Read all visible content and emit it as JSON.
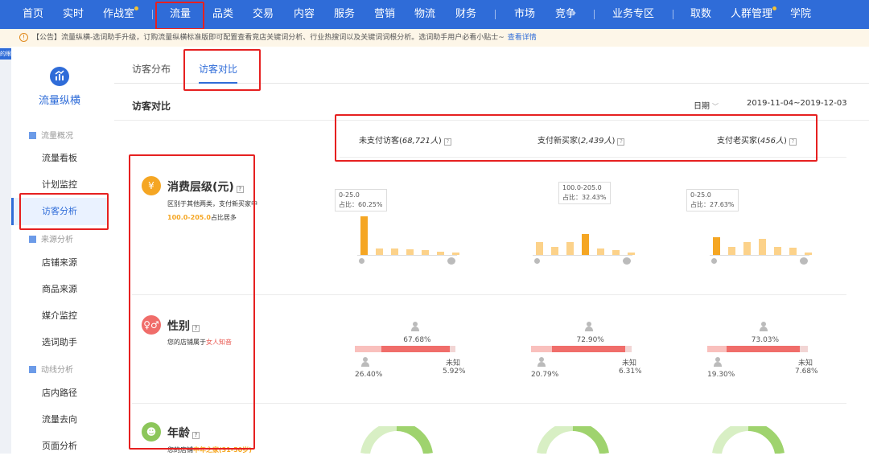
{
  "nav": {
    "items": [
      "首页",
      "实时",
      "作战室",
      "流量",
      "品类",
      "交易",
      "内容",
      "服务",
      "营销",
      "物流",
      "财务",
      "市场",
      "竞争",
      "业务专区",
      "取数",
      "人群管理",
      "学院"
    ],
    "active": "流量",
    "accent": "#2f6cd8"
  },
  "notice": {
    "text": "【公告】流量纵横-选词助手升级，订购流量纵横标准版即可配置查看竞店关键词分析、行业热搜词以及关键词词根分析。选词助手用户必看小贴士~",
    "link": "查看详情"
  },
  "left_strip": {
    "badge": "的眼"
  },
  "sidebar": {
    "title": "流量纵横",
    "sections": [
      {
        "label": "流量概况",
        "items": [
          "流量看板",
          "计划监控",
          "访客分析"
        ]
      },
      {
        "label": "来源分析",
        "items": [
          "店铺来源",
          "商品来源",
          "媒介监控",
          "选词助手"
        ]
      },
      {
        "label": "动线分析",
        "items": [
          "店内路径",
          "流量去向",
          "页面分析"
        ]
      }
    ],
    "active": "访客分析"
  },
  "tabs": [
    "访客分布",
    "访客对比"
  ],
  "active_tab": "访客对比",
  "page_title": "访客对比",
  "date": {
    "label": "日期",
    "range": "2019-11-04~2019-12-03"
  },
  "columns": [
    {
      "label": "未支付访客",
      "count": "68,721人"
    },
    {
      "label": "支付新买家",
      "count": "2,439人"
    },
    {
      "label": "支付老买家",
      "count": "456人"
    }
  ],
  "consumption": {
    "title": "消费层级(元)",
    "icon": "yen-icon",
    "desc_line1": "区别于其他两类，支付新买家中",
    "desc_highlight": "100.0-205.0",
    "desc_suffix": "占比居多",
    "charts": [
      {
        "tip_range": "0-25.0",
        "tip_share": "占比：60.25%",
        "values": [
          60.25,
          10,
          10,
          9,
          7,
          5,
          4
        ],
        "highlight_index": 0
      },
      {
        "tip_range": "100.0-205.0",
        "tip_share": "占比：32.43%",
        "values": [
          20,
          12,
          20,
          32.43,
          10,
          8,
          4
        ],
        "highlight_index": 3
      },
      {
        "tip_range": "0-25.0",
        "tip_share": "占比：27.63%",
        "values": [
          27.63,
          12,
          20,
          25,
          12,
          11,
          3
        ],
        "highlight_index": 0
      }
    ]
  },
  "gender": {
    "title": "性别",
    "icon": "gender-icon",
    "desc_prefix": "您的店铺属于",
    "desc_highlight": "女人知音",
    "charts": [
      {
        "male": "26.40%",
        "female": "67.68%",
        "unknown_label": "未知",
        "unknown": "5.92%",
        "male_v": 26.4,
        "female_v": 67.68,
        "unknown_v": 5.92
      },
      {
        "male": "20.79%",
        "female": "72.90%",
        "unknown_label": "未知",
        "unknown": "6.31%",
        "male_v": 20.79,
        "female_v": 72.9,
        "unknown_v": 6.31
      },
      {
        "male": "19.30%",
        "female": "73.03%",
        "unknown_label": "未知",
        "unknown": "7.68%",
        "male_v": 19.3,
        "female_v": 73.03,
        "unknown_v": 7.68
      }
    ]
  },
  "age": {
    "title": "年龄",
    "icon": "age-icon",
    "desc_prefix": "您的店铺",
    "desc_highlight": "中年之家(31-50岁)"
  },
  "colors": {
    "orange": "#f5a623",
    "orange_light": "#fcd28a",
    "female": "#f06d6a",
    "male": "#f9c0bd",
    "unknown": "#f2d5d4",
    "green": "#9fd36e",
    "green_light": "#d8efc4"
  }
}
